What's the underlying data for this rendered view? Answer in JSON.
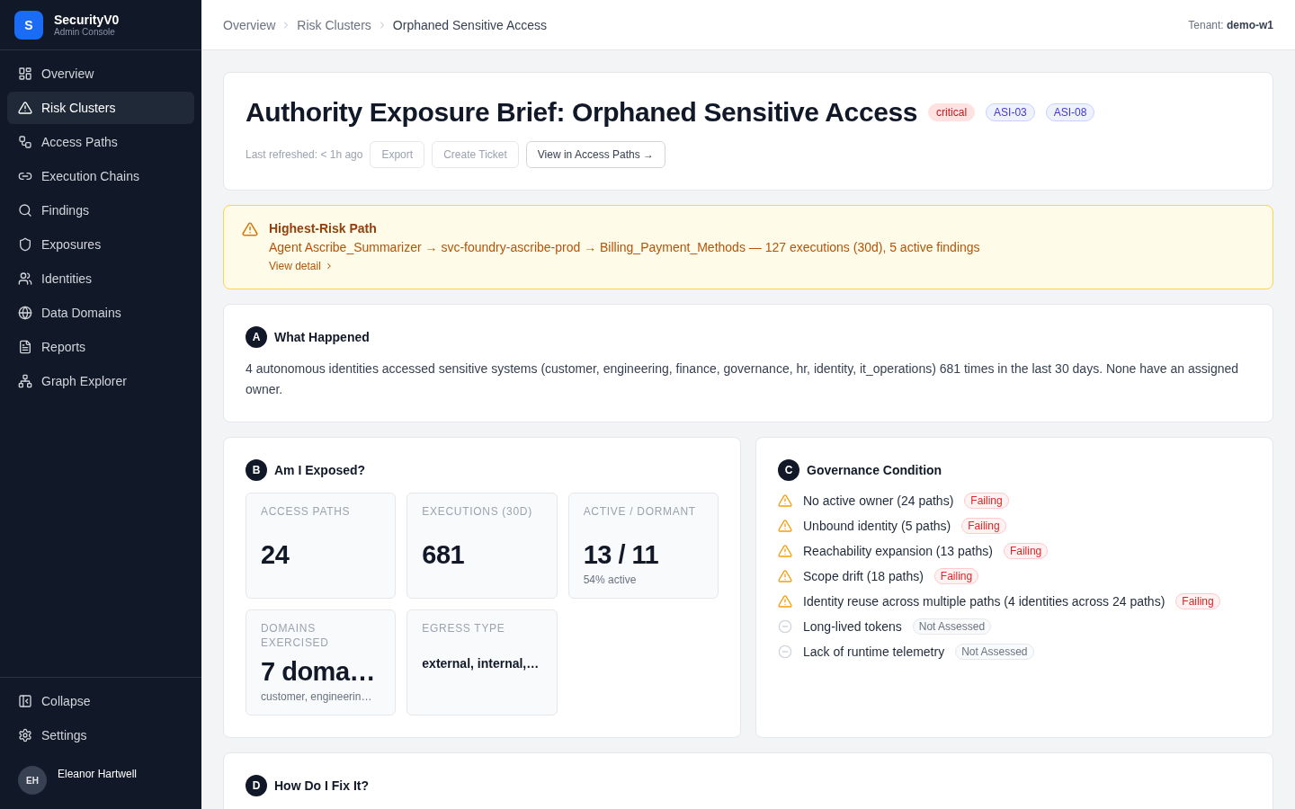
{
  "sidebar": {
    "brand": {
      "logo_letter": "S",
      "name": "SecurityV0",
      "subtitle": "Admin Console"
    },
    "nav": [
      {
        "label": "Overview",
        "selected": false
      },
      {
        "label": "Risk Clusters",
        "selected": true
      },
      {
        "label": "Access Paths",
        "selected": false
      },
      {
        "label": "Execution Chains",
        "selected": false
      },
      {
        "label": "Findings",
        "selected": false
      },
      {
        "label": "Exposures",
        "selected": false
      },
      {
        "label": "Identities",
        "selected": false
      },
      {
        "label": "Data Domains",
        "selected": false
      },
      {
        "label": "Reports",
        "selected": false
      },
      {
        "label": "Graph Explorer",
        "selected": false
      }
    ],
    "footer": [
      {
        "label": "Collapse"
      },
      {
        "label": "Settings"
      }
    ],
    "user": {
      "initials": "EH",
      "name": "Eleanor Hartwell"
    }
  },
  "header": {
    "breadcrumbs": [
      {
        "label": "Overview",
        "current": false
      },
      {
        "label": "Risk Clusters",
        "current": false
      },
      {
        "label": "Orphaned Sensitive Access",
        "current": true
      }
    ],
    "tenant": "Tenant: **demo-w1**"
  },
  "brief": {
    "title": "Authority Exposure Brief: Orphaned Sensitive Access",
    "tags": [
      {
        "label": "critical",
        "kind": "severity"
      },
      {
        "label": "ASI-03",
        "kind": "framework"
      },
      {
        "label": "ASI-08",
        "kind": "framework"
      }
    ],
    "refreshed": "Last refreshed: < 1h ago",
    "actions": [
      {
        "label": "Export",
        "disabled": true
      },
      {
        "label": "Create Ticket",
        "disabled": true
      },
      {
        "label": "View in Access Paths →",
        "disabled": false
      }
    ]
  },
  "alert": {
    "title": "Highest-Risk Path",
    "text": "Agent Ascribe_Summarizer → svc-foundry-ascribe-prod → Billing_Payment_Methods — 127 executions (30d), 5 active findings",
    "link": "View detail"
  },
  "what_happened": {
    "letter": "A",
    "title": "What Happened",
    "text": "4 autonomous identities accessed sensitive systems (customer, engineering, finance, governance, hr, identity, it_operations) 681 times in the last 30 days. None have an assigned owner."
  },
  "exposure": {
    "letter": "B",
    "title": "Am I Exposed?",
    "metrics": [
      {
        "label": "ACCESS PATHS",
        "value": "24",
        "kind": "number"
      },
      {
        "label": "EXECUTIONS (30D)",
        "value": "681",
        "kind": "number"
      },
      {
        "label": "ACTIVE / DORMANT",
        "value": "13 / 11",
        "note": "54% active",
        "kind": "number"
      },
      {
        "label": "DOMAINS EXERCISED",
        "value": "7 doma…",
        "note": "customer, engineerin…",
        "kind": "number"
      },
      {
        "label": "EGRESS TYPE",
        "value": "external, internal,…",
        "kind": "text"
      }
    ]
  },
  "governance": {
    "letter": "C",
    "title": "Governance Condition",
    "conditions": [
      {
        "text": "No active owner (24 paths)",
        "status": "Failing",
        "kind": "failing"
      },
      {
        "text": "Unbound identity (5 paths)",
        "status": "Failing",
        "kind": "failing"
      },
      {
        "text": "Reachability expansion (13 paths)",
        "status": "Failing",
        "kind": "failing"
      },
      {
        "text": "Scope drift (18 paths)",
        "status": "Failing",
        "kind": "failing"
      },
      {
        "text": "Identity reuse across multiple paths (4 identities across 24 paths)",
        "status": "Failing",
        "kind": "failing"
      },
      {
        "text": "Long-lived tokens",
        "status": "Not Assessed",
        "kind": "not_assessed"
      },
      {
        "text": "Lack of runtime telemetry",
        "status": "Not Assessed",
        "kind": "not_assessed"
      }
    ]
  },
  "fix": {
    "letter": "D",
    "title": "How Do I Fix It?"
  }
}
